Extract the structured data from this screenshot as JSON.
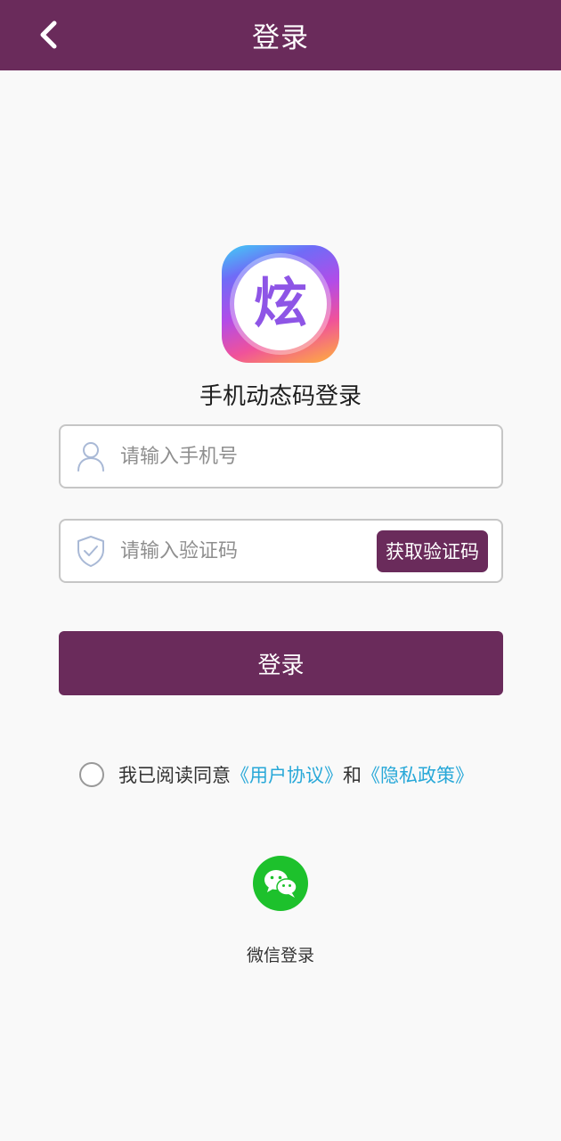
{
  "header": {
    "title": "登录"
  },
  "logo": {
    "glyph": "炫"
  },
  "subtitle": "手机动态码登录",
  "phone_field": {
    "value": "",
    "placeholder": "请输入手机号"
  },
  "code_field": {
    "value": "",
    "placeholder": "请输入验证码",
    "button_label": "获取验证码"
  },
  "login_button": {
    "label": "登录"
  },
  "agreement": {
    "prefix": "我已阅读同意",
    "user_agreement": "《用户协议》",
    "conjunction": "和",
    "privacy_policy": "《隐私政策》",
    "checked": false
  },
  "wechat": {
    "label": "微信登录"
  },
  "colors": {
    "brand": "#6a2b5b",
    "link": "#28a8d8",
    "wechat": "#1dc12c",
    "background": "#f9f9f9"
  }
}
